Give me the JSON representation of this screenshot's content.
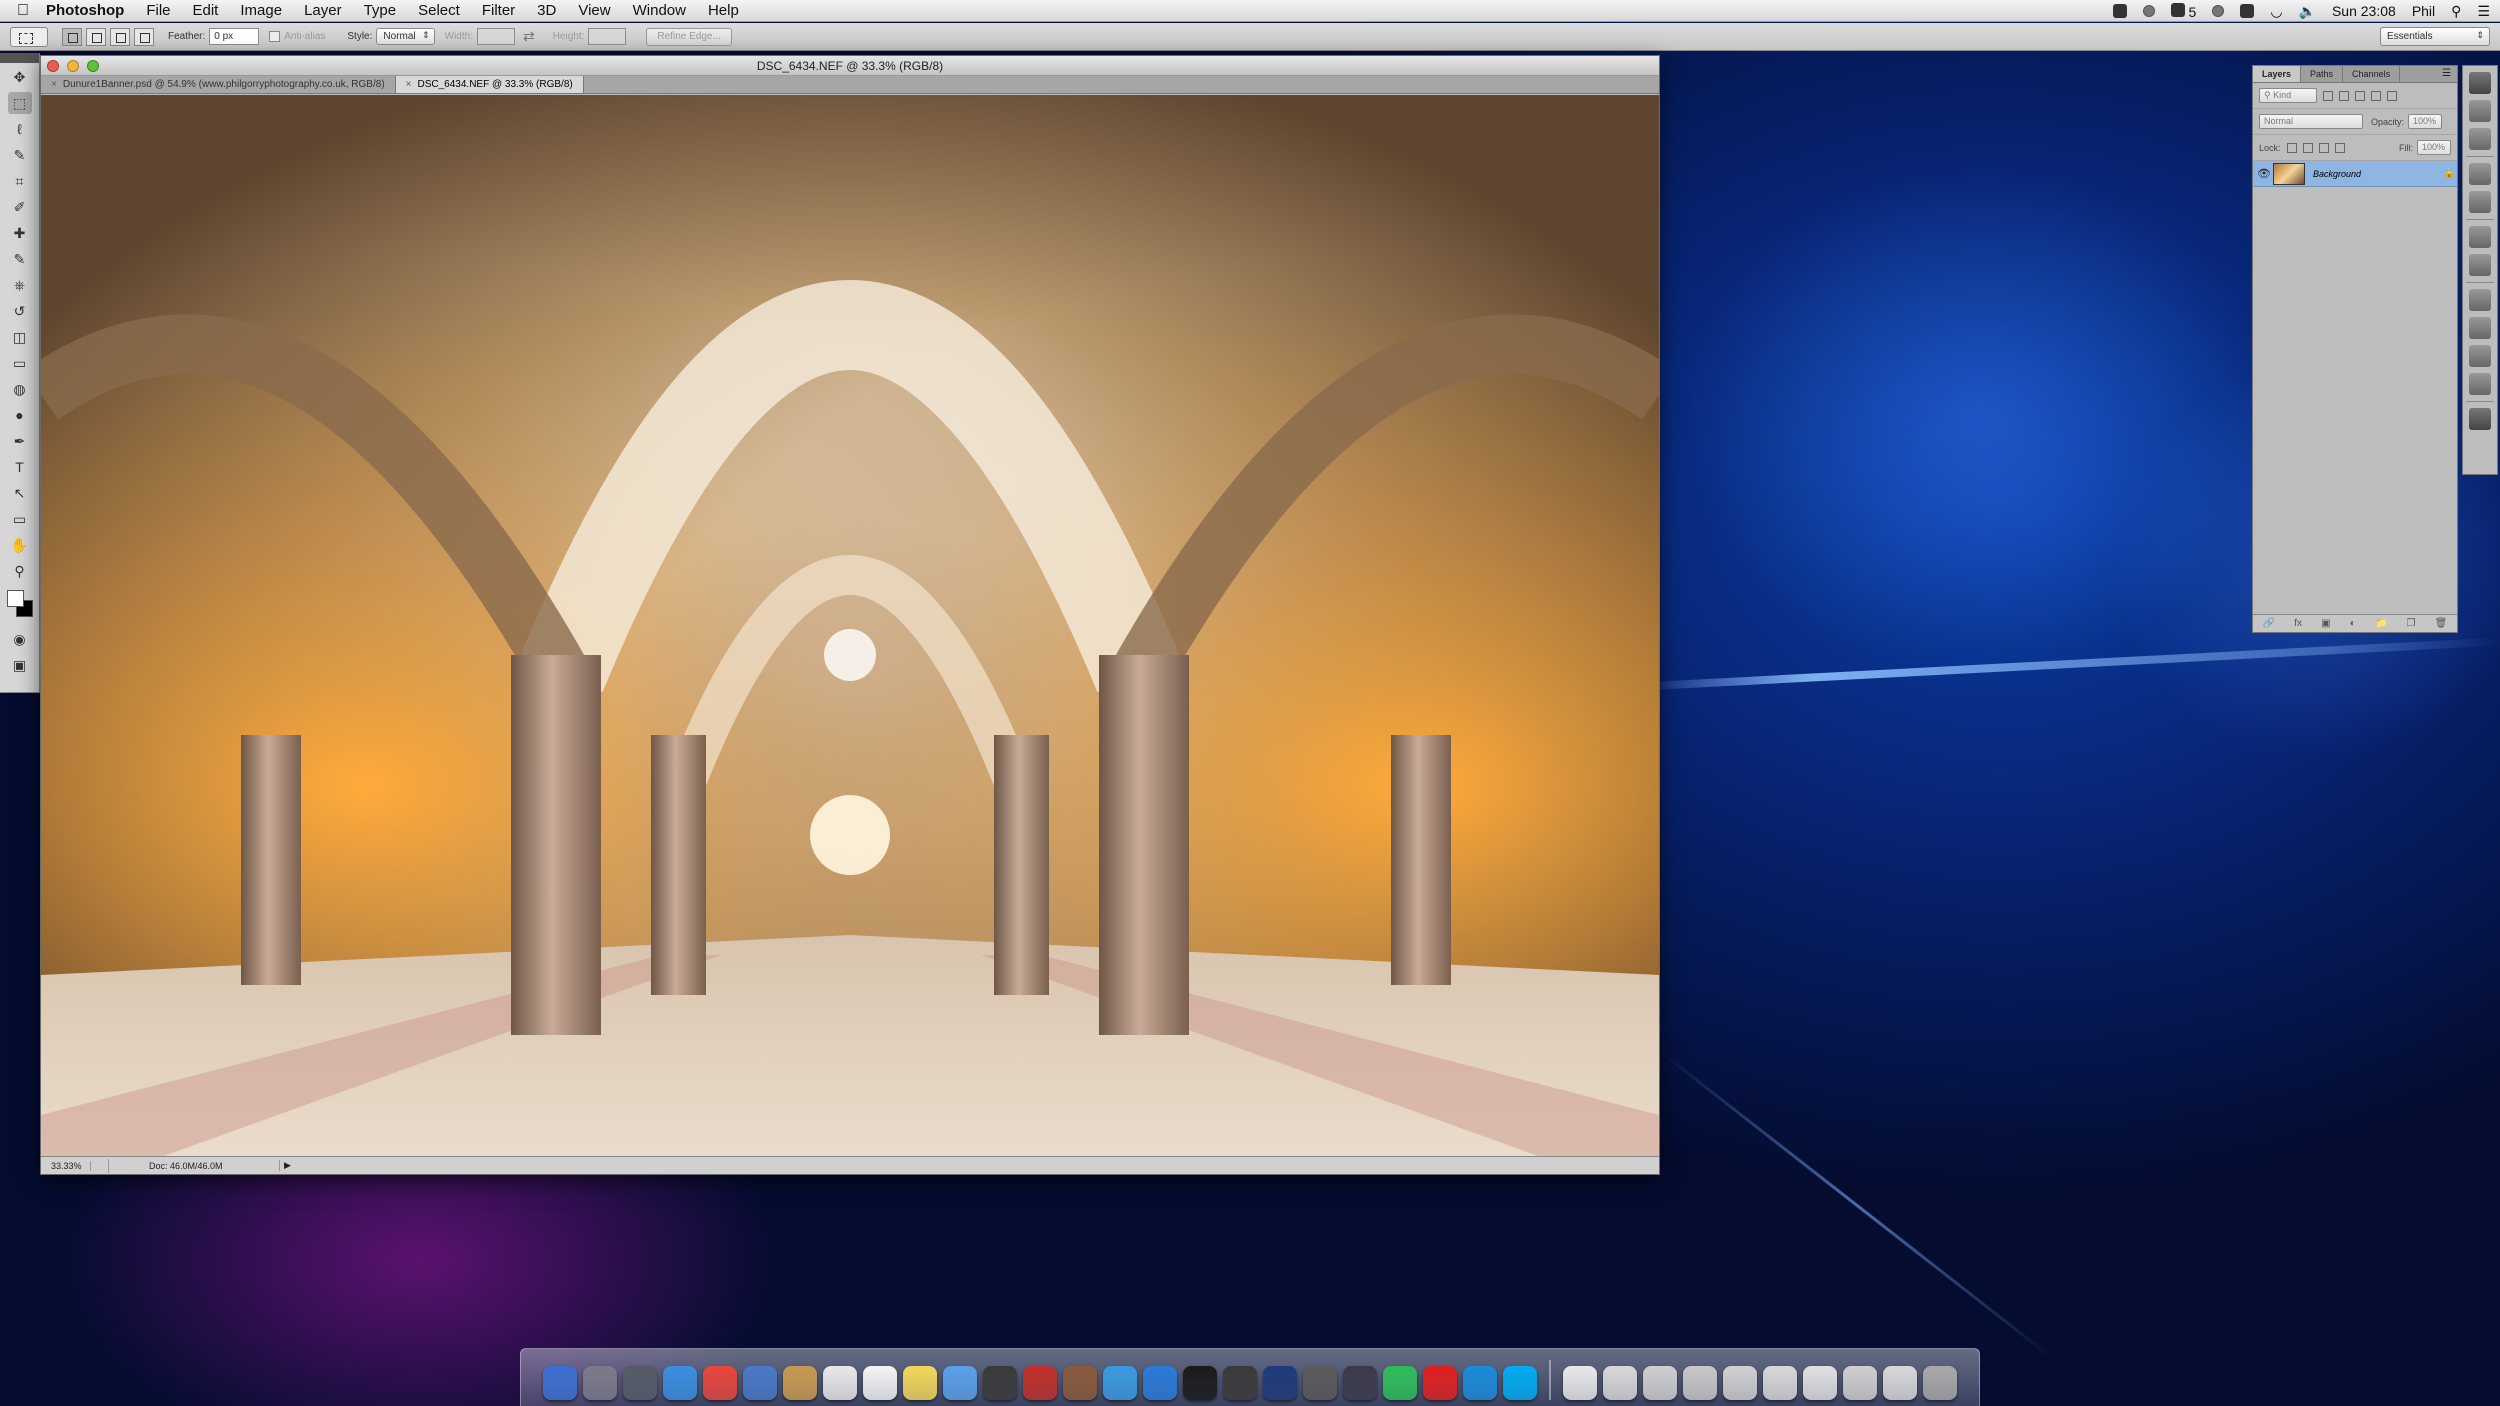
{
  "menubar": {
    "app": "Photoshop",
    "items": [
      "File",
      "Edit",
      "Image",
      "Layer",
      "Type",
      "Select",
      "Filter",
      "3D",
      "View",
      "Window",
      "Help"
    ],
    "status": {
      "notifications_count": "5",
      "clock": "Sun 23:08",
      "user": "Phil",
      "icons": [
        "dropbox-icon",
        "creative-cloud-icon",
        "evernote-icon",
        "time-machine-icon",
        "bluetooth-icon",
        "wifi-icon",
        "volume-icon",
        "spotlight-icon",
        "notification-center-icon"
      ]
    }
  },
  "options": {
    "feather_label": "Feather:",
    "feather_value": "0 px",
    "antialias_label": "Anti-alias",
    "style_label": "Style:",
    "style_value": "Normal",
    "width_label": "Width:",
    "height_label": "Height:",
    "refine_label": "Refine Edge...",
    "workspace": "Essentials"
  },
  "tools": [
    "move-tool",
    "marquee-tool",
    "lasso-tool",
    "quick-selection-tool",
    "crop-tool",
    "eyedropper-tool",
    "spot-healing-tool",
    "brush-tool",
    "clone-stamp-tool",
    "history-brush-tool",
    "eraser-tool",
    "gradient-tool",
    "blur-tool",
    "dodge-tool",
    "pen-tool",
    "type-tool",
    "path-selection-tool",
    "rectangle-tool",
    "hand-tool",
    "zoom-tool"
  ],
  "tool_glyphs": [
    "✥",
    "⬚",
    "ℓ",
    "✎",
    "⌗",
    "✐",
    "✚",
    "✎",
    "⎈",
    "↺",
    "◫",
    "▭",
    "◍",
    "●",
    "✒",
    "T",
    "↖",
    "▭",
    "✋",
    "⚲"
  ],
  "document": {
    "window_title": "DSC_6434.NEF @ 33.3% (RGB/8)",
    "tabs": [
      {
        "label": "Dunure1Banner.psd @ 54.9% (www.philgorryphotography.co.uk, RGB/8)",
        "active": false
      },
      {
        "label": "DSC_6434.NEF @ 33.3% (RGB/8)",
        "active": true
      }
    ],
    "zoom": "33.33%",
    "doc_info": "Doc: 46.0M/46.0M"
  },
  "layers_panel": {
    "tabs": [
      "Layers",
      "Paths",
      "Channels"
    ],
    "kind_label": "Kind",
    "blend_mode": "Normal",
    "opacity_label": "Opacity:",
    "opacity_value": "100%",
    "lock_label": "Lock:",
    "fill_label": "Fill:",
    "fill_value": "100%",
    "layers": [
      {
        "name": "Background",
        "locked": true
      }
    ],
    "footer_icons": [
      "link-icon",
      "fx-icon",
      "mask-icon",
      "adjustment-icon",
      "group-icon",
      "new-layer-icon",
      "trash-icon"
    ]
  },
  "dock_colors": [
    "#3b6fd0",
    "#7a7a8a",
    "#555b66",
    "#3a8ee0",
    "#e8453c",
    "#4a78c8",
    "#c89a50",
    "#e8e8e8",
    "#f4f4f4",
    "#f2d75a",
    "#5aa0e8",
    "#3a3a3a",
    "#c0302a",
    "#8a5a3a",
    "#3a9ae0",
    "#2a7ad8",
    "#1a1a1a",
    "#3a3a3a",
    "#1d3a7a",
    "#5a5a5a",
    "#3a3a4a",
    "#2ebd59",
    "#e02020",
    "#1a8ad8",
    "#00aaf0",
    "#e8e8e8",
    "#d8d8d8",
    "#cfcfcf",
    "#c8c8c8",
    "#d0d0d0",
    "#d8d8d8",
    "#e0e0e0",
    "#cfcfcf",
    "#d8d8d8",
    "#a8a8a8"
  ]
}
